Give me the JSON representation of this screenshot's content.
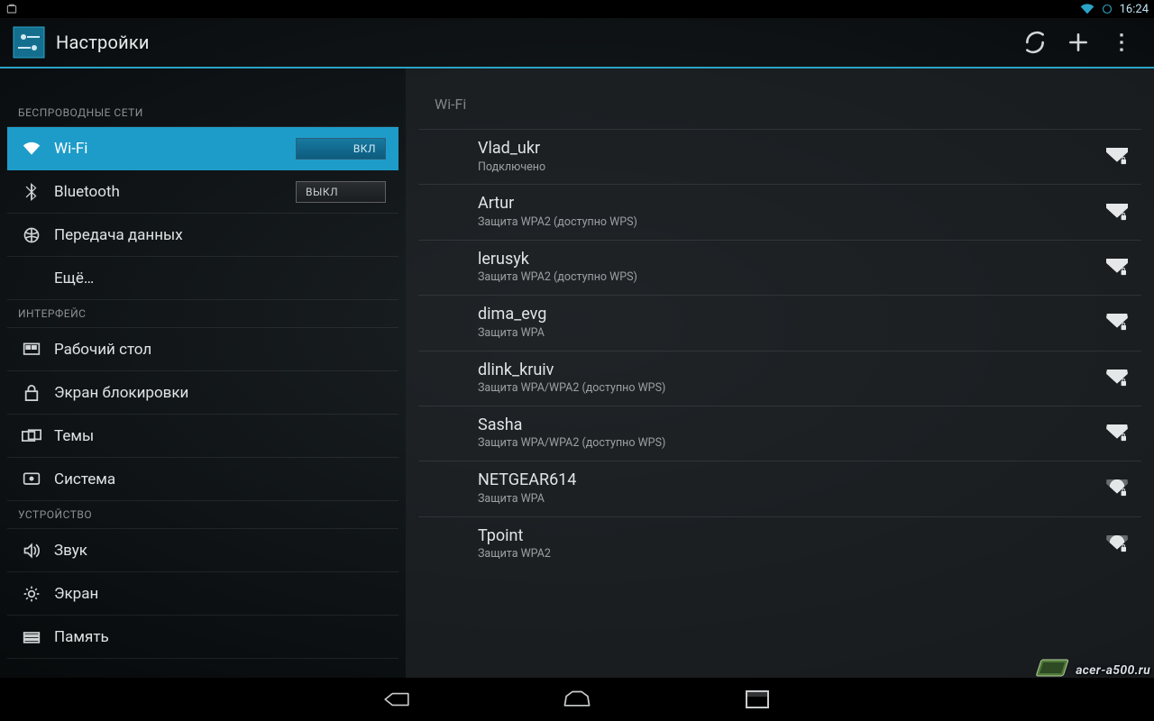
{
  "status": {
    "time": "16:24"
  },
  "actionbar": {
    "title": "Настройки"
  },
  "sidebar": {
    "sections": [
      {
        "header": "БЕСПРОВОДНЫЕ СЕТИ",
        "items": [
          {
            "label": "Wi-Fi",
            "toggle": "ВКЛ",
            "toggleState": "on",
            "selected": true
          },
          {
            "label": "Bluetooth",
            "toggle": "ВЫКЛ",
            "toggleState": "off"
          },
          {
            "label": "Передача данных"
          },
          {
            "label": "Ещё…"
          }
        ]
      },
      {
        "header": "ИНТЕРФЕЙС",
        "items": [
          {
            "label": "Рабочий стол"
          },
          {
            "label": "Экран блокировки"
          },
          {
            "label": "Темы"
          },
          {
            "label": "Система"
          }
        ]
      },
      {
        "header": "УСТРОЙСТВО",
        "items": [
          {
            "label": "Звук"
          },
          {
            "label": "Экран"
          },
          {
            "label": "Память"
          }
        ]
      }
    ]
  },
  "pane": {
    "title": "Wi-Fi",
    "networks": [
      {
        "name": "Vlad_ukr",
        "sub": "Подключено",
        "strength": 4
      },
      {
        "name": "Artur",
        "sub": "Защита WPA2 (доступно WPS)",
        "strength": 4
      },
      {
        "name": "lerusyk",
        "sub": "Защита WPA2 (доступно WPS)",
        "strength": 4
      },
      {
        "name": "dima_evg",
        "sub": "Защита WPA",
        "strength": 3
      },
      {
        "name": "dlink_kruiv",
        "sub": "Защита WPA/WPA2 (доступно WPS)",
        "strength": 3
      },
      {
        "name": "Sasha",
        "sub": "Защита WPA/WPA2 (доступно WPS)",
        "strength": 3
      },
      {
        "name": "NETGEAR614",
        "sub": "Защита WPA",
        "strength": 2
      },
      {
        "name": "Tpoint",
        "sub": "Защита WPA2",
        "strength": 2
      }
    ]
  },
  "watermark": {
    "text": "acer-a500.ru"
  }
}
